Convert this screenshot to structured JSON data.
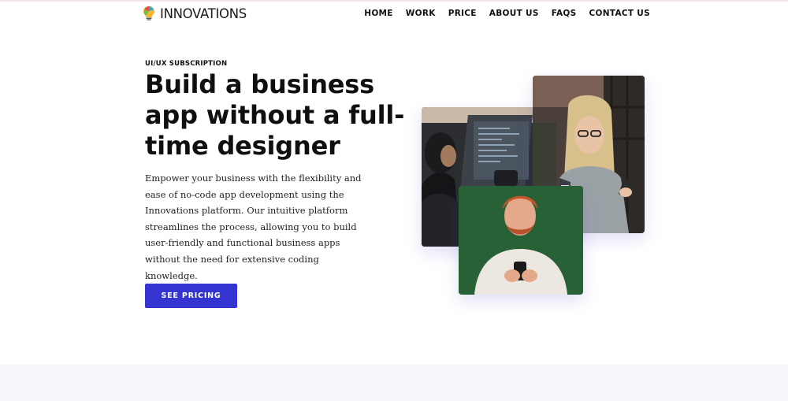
{
  "brand": {
    "name": "INNOVATIONS",
    "icon": "lightbulb-puzzle-icon",
    "colors": [
      "#f2b632",
      "#e8503a",
      "#2fa7d8",
      "#6cbf4b"
    ]
  },
  "nav": {
    "items": [
      {
        "label": "HOME"
      },
      {
        "label": "WORK"
      },
      {
        "label": "PRICE"
      },
      {
        "label": "ABOUT US"
      },
      {
        "label": "FAQS"
      },
      {
        "label": "CONTACT US"
      }
    ]
  },
  "hero": {
    "eyebrow": "UI/UX SUBSCRIPTION",
    "headline": "Build a business app without a full-time designer",
    "description": "Empower your business with the flexibility and ease of no-code app development using the Innovations platform. Our intuitive platform streamlines the process, allowing you to build user-friendly and functional business apps without the need for extensive coding knowledge.",
    "cta_label": "SEE PRICING"
  },
  "colors": {
    "accent": "#3434d0",
    "footer_band": "#f4f6f9",
    "text": "#111111"
  }
}
